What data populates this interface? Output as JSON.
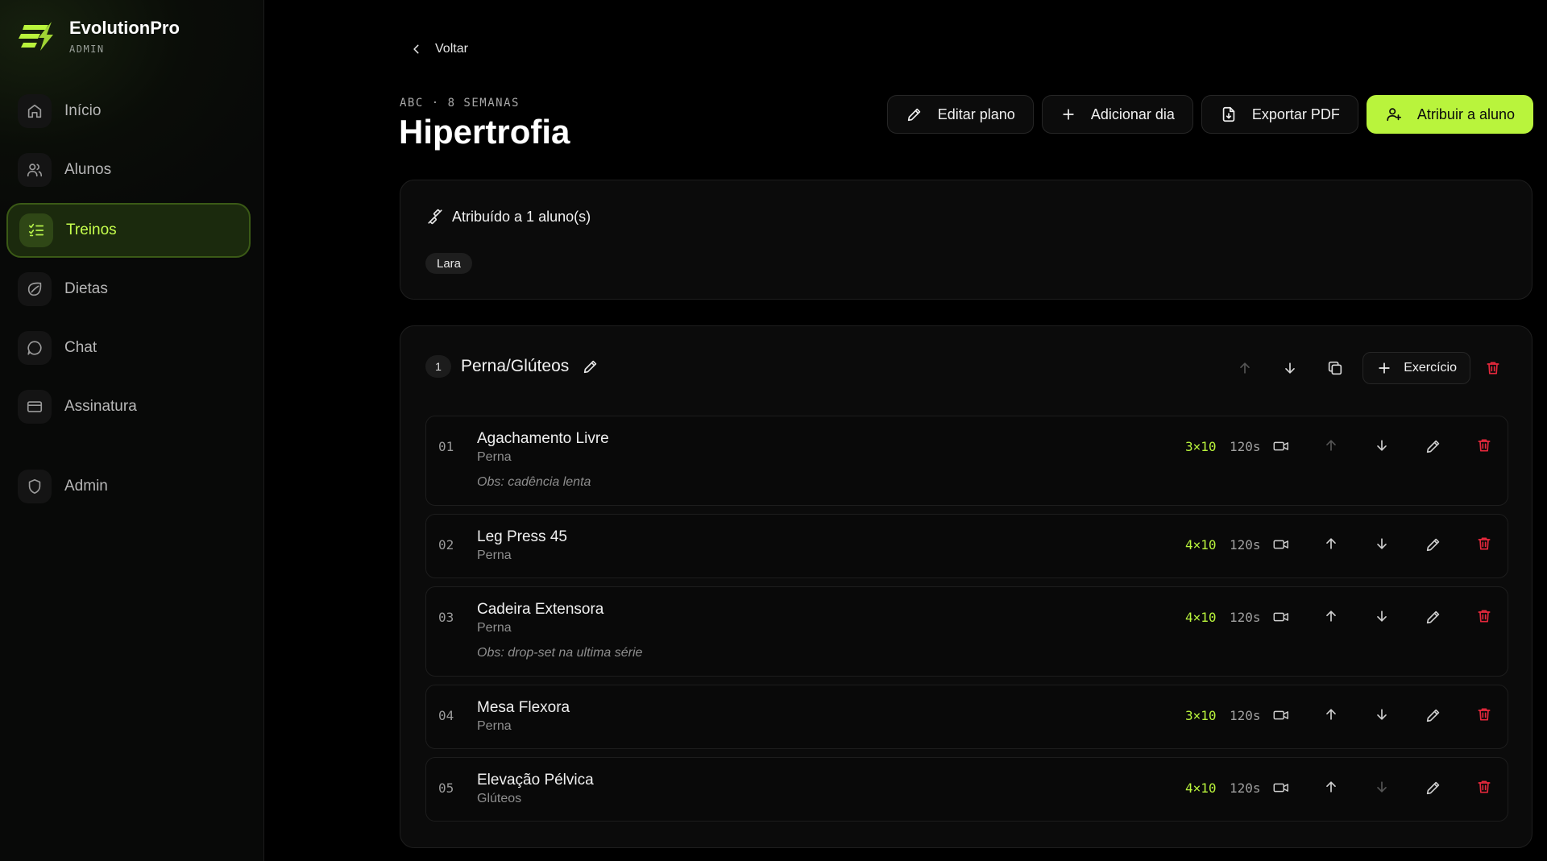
{
  "brand": {
    "name": "EvolutionPro",
    "role": "ADMIN"
  },
  "nav": [
    {
      "label": "Início",
      "icon": "home-icon",
      "active": false
    },
    {
      "label": "Alunos",
      "icon": "users-icon",
      "active": false
    },
    {
      "label": "Treinos",
      "icon": "checklist-icon",
      "active": true
    },
    {
      "label": "Dietas",
      "icon": "leaf-icon",
      "active": false
    },
    {
      "label": "Chat",
      "icon": "chat-icon",
      "active": false
    },
    {
      "label": "Assinatura",
      "icon": "card-icon",
      "active": false
    },
    {
      "label": "Admin",
      "icon": "shield-icon",
      "active": false
    }
  ],
  "page": {
    "back_label": "Voltar",
    "subtitle": "ABC · 8 SEMANAS",
    "title": "Hipertrofia",
    "actions": {
      "edit": "Editar plano",
      "add_day": "Adicionar dia",
      "export": "Exportar PDF",
      "assign": "Atribuir a aluno"
    }
  },
  "assigned": {
    "heading": "Atribuído a 1 aluno(s)",
    "students": [
      "Lara"
    ]
  },
  "day": {
    "number": "1",
    "name": "Perna/Glúteos",
    "add_exercise_label": "Exercício",
    "exercises": [
      {
        "index": "01",
        "name": "Agachamento Livre",
        "group": "Perna",
        "sets": "3×10",
        "rest": "120s",
        "obs": "Obs: cadência lenta"
      },
      {
        "index": "02",
        "name": "Leg Press 45",
        "group": "Perna",
        "sets": "4×10",
        "rest": "120s",
        "obs": ""
      },
      {
        "index": "03",
        "name": "Cadeira Extensora",
        "group": "Perna",
        "sets": "4×10",
        "rest": "120s",
        "obs": "Obs: drop-set na ultima série"
      },
      {
        "index": "04",
        "name": "Mesa Flexora",
        "group": "Perna",
        "sets": "3×10",
        "rest": "120s",
        "obs": ""
      },
      {
        "index": "05",
        "name": "Elevação Pélvica",
        "group": "Glúteos",
        "sets": "4×10",
        "rest": "120s",
        "obs": ""
      }
    ]
  },
  "colors": {
    "accent": "#b9f43c",
    "danger": "#e5283c",
    "background": "#000000"
  }
}
